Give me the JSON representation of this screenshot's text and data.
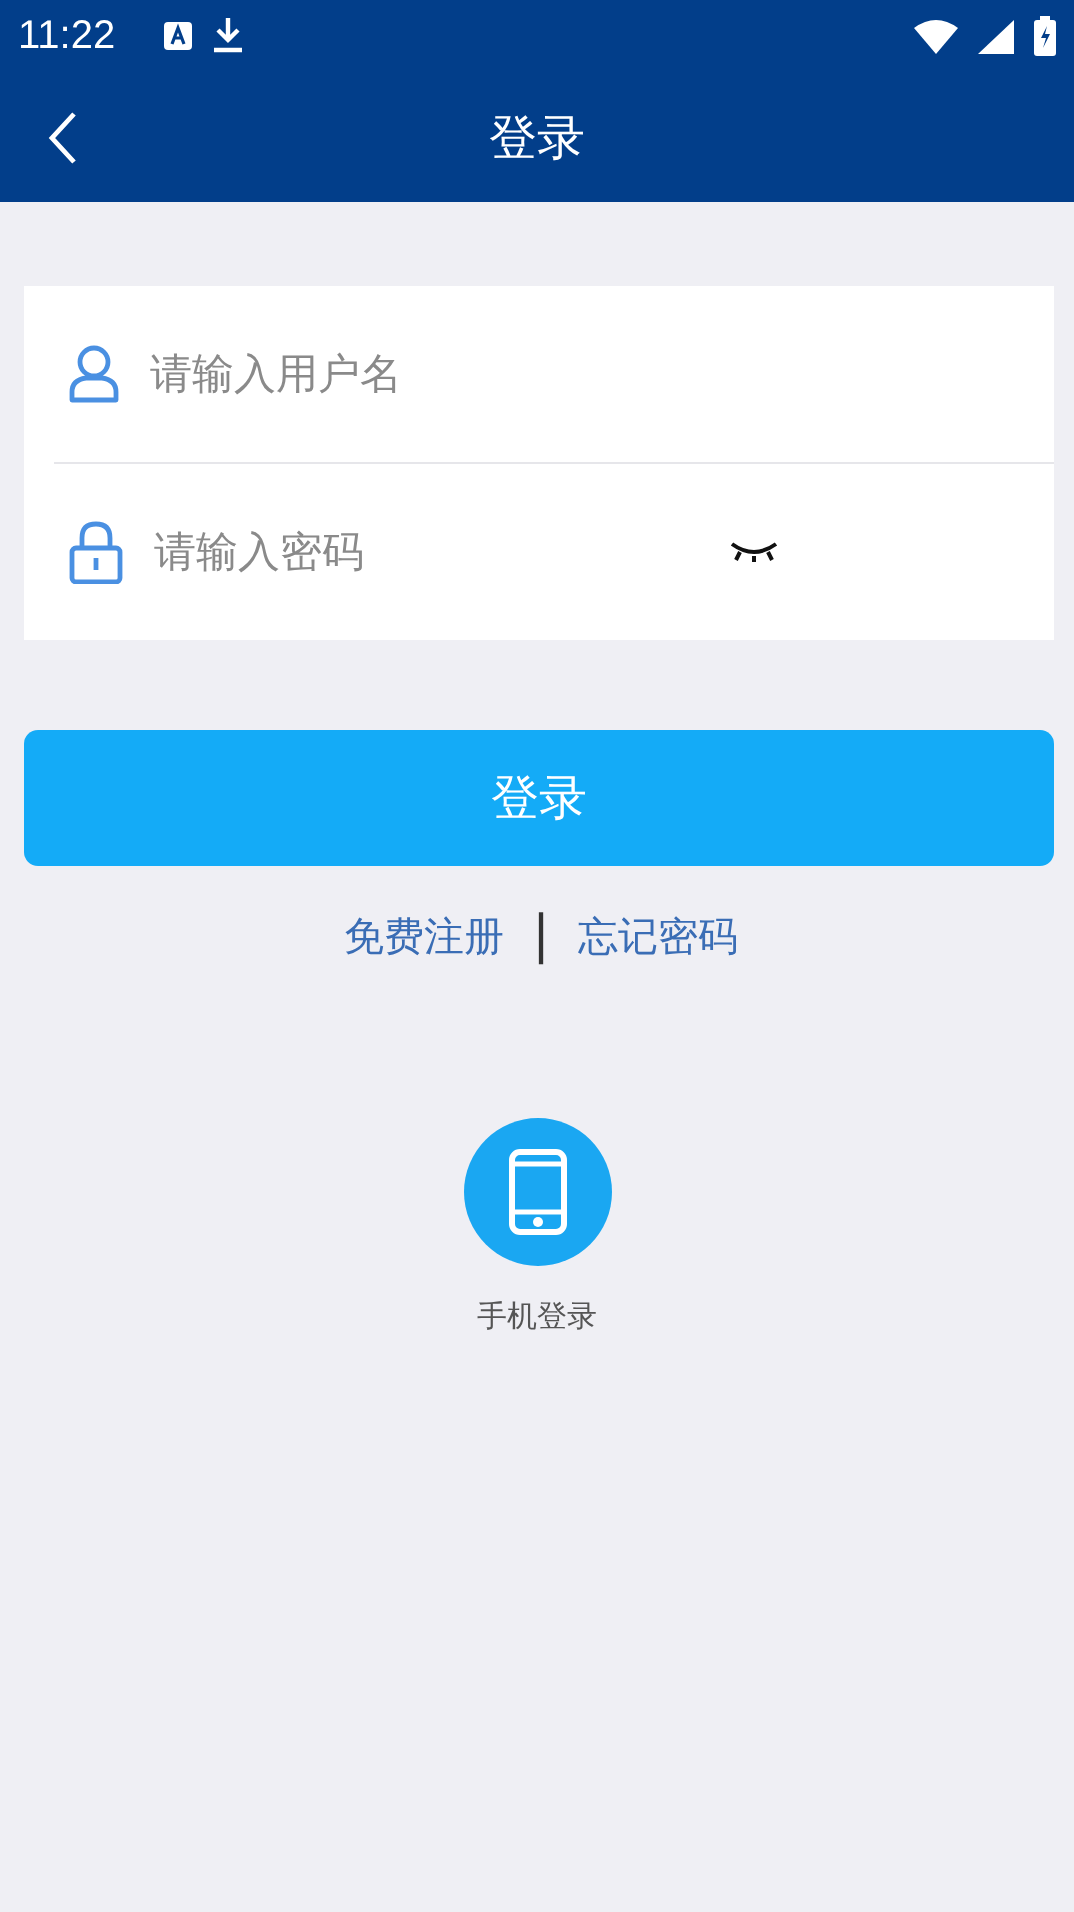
{
  "status_bar": {
    "time": "11:22"
  },
  "app_bar": {
    "title": "登录"
  },
  "form": {
    "username": {
      "placeholder": "请输入用户名"
    },
    "password": {
      "placeholder": "请输入密码"
    }
  },
  "login_button": "登录",
  "links": [
    "免费注册",
    "忘记密码"
  ],
  "separator": "|",
  "alt_login": {
    "label": "手机登录"
  }
}
